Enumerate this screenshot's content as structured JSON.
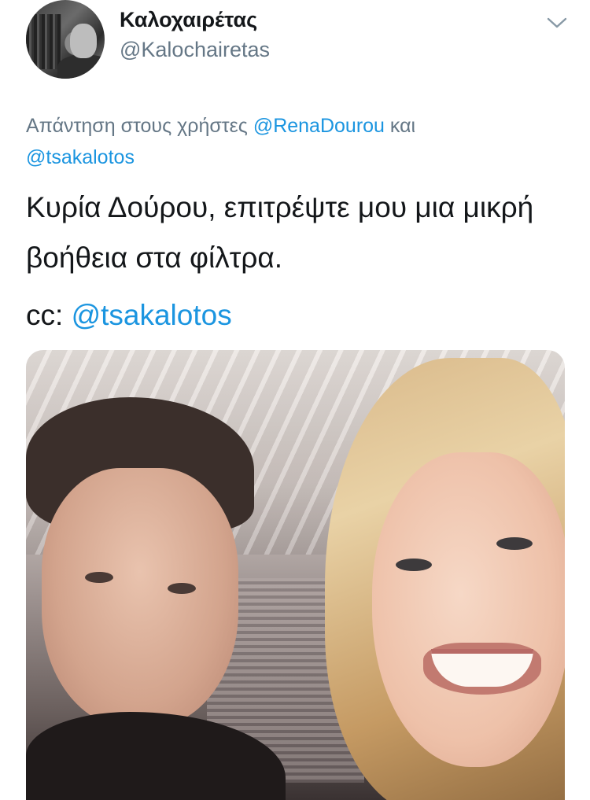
{
  "user": {
    "display_name": "Καλοχαιρέτας",
    "handle": "@Kalochairetas"
  },
  "reply": {
    "prefix": "Απάντηση στους χρήστες",
    "mention_1": "@RenaDourou",
    "conjunction": "και",
    "mention_2": "@tsakalotos"
  },
  "tweet": {
    "text": "Κυρία Δούρου, επιτρέψτε μου μια μικρή βοήθεια στα φίλτρα.",
    "cc_prefix": "cc:",
    "cc_mention": "@tsakalotos"
  },
  "icons": {
    "menu": "chevron-down-icon",
    "avatar": "profile-photo"
  },
  "colors": {
    "link": "#1b95e0",
    "secondary_text": "#657786",
    "primary_text": "#14171a"
  }
}
